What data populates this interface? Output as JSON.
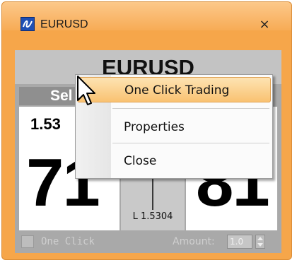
{
  "window": {
    "title": "EURUSD",
    "close_glyph": "×",
    "accent_color": "#f6a64a"
  },
  "panel": {
    "symbol": "EURUSD",
    "sell": {
      "label": "Sel",
      "price_prefix": "1.53",
      "big_digits": "71"
    },
    "buy": {
      "big_digits": "81"
    },
    "low": "L 1.5304",
    "one_click_label": "One Click",
    "one_click_checked": false,
    "amount_label": "Amount:",
    "amount_value": "1.0"
  },
  "context_menu": {
    "items": [
      {
        "label": "One Click Trading",
        "highlighted": true
      },
      {
        "label": "Properties",
        "highlighted": false
      },
      {
        "label": "Close",
        "highlighted": false
      }
    ]
  },
  "icons": {
    "app": "app-logo-icon",
    "close": "close-icon",
    "cursor": "mouse-pointer-icon",
    "spinner_up": "spin-up-icon",
    "spinner_down": "spin-down-icon"
  }
}
